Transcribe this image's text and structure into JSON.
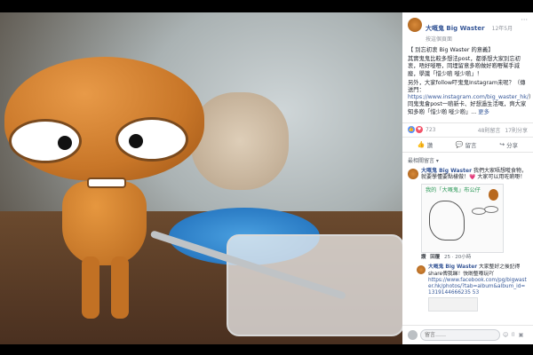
{
  "post": {
    "page_name": "大嘅鬼 Big Waster",
    "time": "12年5月",
    "sub": "按這個頁面",
    "body_lines": [
      "【 別忘初衷 Big Waster 的意義】",
      "其實鬼鬼比較多想法post，都係想大家別忘初衷，唔好嘥嘢，同埋留意多啲做好啲嘢幫手減廢，學識「惜少啲 嘥少啲」！",
      "另外，大家follow吓鬼鬼Instagram未呢？（傳送門：",
      "https://www.instagram.com/big_waster_hk/",
      "）同鬼鬼會post一啲新卡、好想過生活嘅，齊大家知多啲「惜少啲 嘥少啲」..."
    ],
    "see_more": "更多"
  },
  "reactions": {
    "count": "723",
    "comments": "48則留言",
    "shares": "17則分享"
  },
  "actions": {
    "like": "讚",
    "comment": "留言",
    "share": "分享"
  },
  "comments": {
    "sort_label": "最相關留言 ▾",
    "first": {
      "author": "大嘅鬼 Big Waster",
      "text": "我們大家唔想嘥食物，就要學懂要點樣做！💗 大家可以用咗啲嘢！",
      "image_title": "我的「大嘅鬼」布公仔",
      "meta_like": "讚",
      "meta_reply": "回覆",
      "meta_time": "25 · 20小時"
    },
    "reply": {
      "author": "大嘅鬼 Big Waster",
      "text": "大家整好之後記得share俾我睇！快啲整嚟玩吖",
      "link": "https://www.facebook.com/pg/bigwaster.hk/photos/?tab=album&album_id=1319144666235 53"
    }
  },
  "input": {
    "placeholder": "留言……",
    "icons": "☺ ⌷ ▣"
  }
}
